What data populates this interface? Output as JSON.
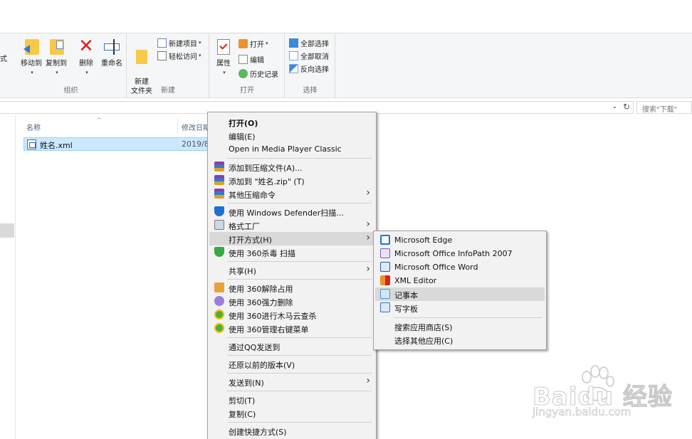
{
  "ribbon": {
    "clipped_label": "式",
    "groups": {
      "organize": {
        "label": "组织",
        "move_to": "移动到",
        "copy_to": "复制到",
        "delete": "删除",
        "rename": "重命名"
      },
      "new": {
        "label": "新建",
        "new_folder": "新建\n文件夹",
        "new_item": "新建项目",
        "easy_access": "轻松访问"
      },
      "open": {
        "label": "打开",
        "properties": "属性",
        "open": "打开",
        "edit": "编辑",
        "history": "历史记录"
      },
      "select": {
        "label": "选择",
        "select_all": "全部选择",
        "select_none": "全部取消",
        "invert": "反向选择"
      }
    }
  },
  "address": {
    "search_placeholder": "搜索\"下载\""
  },
  "file_list": {
    "columns": {
      "name": "名称",
      "modified": "修改日期"
    },
    "files": [
      {
        "name": "姓名.xml",
        "modified": "2019/8/"
      }
    ]
  },
  "context_menu": {
    "items": [
      {
        "label": "打开(O)",
        "bold": true
      },
      {
        "label": "编辑(E)"
      },
      {
        "label": "Open in Media Player Classic"
      },
      {
        "label": "添加到压缩文件(A)...",
        "icon": "winrar-icon"
      },
      {
        "label": "添加到 \"姓名.zip\" (T)",
        "icon": "winrar-icon"
      },
      {
        "label": "其他压缩命令",
        "icon": "winrar-icon",
        "submenu": true
      },
      {
        "label": "使用 Windows Defender扫描...",
        "icon": "defender-shield-icon"
      },
      {
        "label": "格式工厂",
        "icon": "format-factory-icon",
        "submenu": true
      },
      {
        "label": "打开方式(H)",
        "submenu": true,
        "highlighted": true
      },
      {
        "label": "使用 360杀毒 扫描",
        "icon": "360-antivirus-icon"
      },
      {
        "label": "共享(H)",
        "submenu": true
      },
      {
        "label": "使用 360解除占用",
        "icon": "360-unlock-icon"
      },
      {
        "label": "使用 360强力删除",
        "icon": "360-delete-icon"
      },
      {
        "label": "使用 360进行木马云查杀",
        "icon": "360-trojan-icon"
      },
      {
        "label": "使用 360管理右键菜单",
        "icon": "360-menu-icon"
      },
      {
        "label": "通过QQ发送到"
      },
      {
        "label": "还原以前的版本(V)"
      },
      {
        "label": "发送到(N)",
        "submenu": true
      },
      {
        "label": "剪切(T)"
      },
      {
        "label": "复制(C)"
      },
      {
        "label": "创建快捷方式(S)"
      }
    ]
  },
  "open_with_menu": {
    "items": [
      {
        "label": "Microsoft Edge",
        "icon": "edge-icon"
      },
      {
        "label": "Microsoft Office InfoPath 2007",
        "icon": "infopath-icon"
      },
      {
        "label": "Microsoft Office Word",
        "icon": "word-icon"
      },
      {
        "label": "XML Editor",
        "icon": "xml-editor-icon"
      },
      {
        "label": "记事本",
        "icon": "notepad-icon",
        "highlighted": true
      },
      {
        "label": "写字板",
        "icon": "wordpad-icon"
      },
      {
        "label": "搜索应用商店(S)"
      },
      {
        "label": "选择其他应用(C)"
      }
    ]
  },
  "watermark": {
    "main": "Baidu 经验",
    "sub": "jingyan.baidu.com"
  },
  "colors": {
    "selection": "#cce8ff",
    "menu_bg": "#f2f2f2",
    "menu_highlight": "#d9d9d9",
    "ribbon_bg": "#f5f6f7"
  }
}
